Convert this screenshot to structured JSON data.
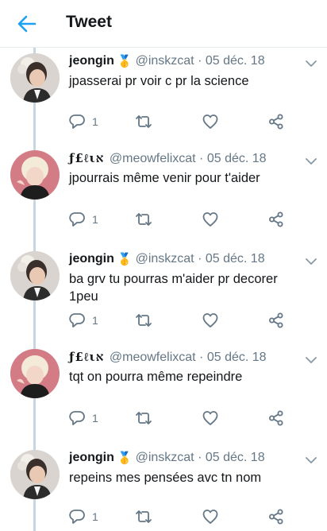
{
  "header": {
    "title": "Tweet",
    "accent": "#1da1f2"
  },
  "colors": {
    "text": "#14171a",
    "secondary": "#657786",
    "thread_line": "#c8d6e1",
    "icon": "#657786"
  },
  "icons": {
    "back": "back-arrow-icon",
    "more": "chevron-down-icon",
    "reply": "reply-icon",
    "retweet": "retweet-icon",
    "like": "heart-icon",
    "share": "share-icon",
    "medal": "medal-icon"
  },
  "tweets": [
    {
      "display_name": "jeongin",
      "medal": "🥇",
      "handle": "@inskzcat",
      "separator": "·",
      "date": "05 déc. 18",
      "text": "jpasserai pr voir c pr la science",
      "reply_count": "1"
    },
    {
      "display_name": "ƒ£ℓιא",
      "medal": "",
      "handle": "@meowfelixcat",
      "separator": "·",
      "date": "05 déc. 18",
      "text": "jpourrais même venir pour t'aider",
      "reply_count": "1"
    },
    {
      "display_name": "jeongin",
      "medal": "🥇",
      "handle": "@inskzcat",
      "separator": "·",
      "date": "05 déc. 18",
      "text": "ba grv tu pourras m'aider pr decorer 1peu",
      "reply_count": "1"
    },
    {
      "display_name": "ƒ£ℓιא",
      "medal": "",
      "handle": "@meowfelixcat",
      "separator": "·",
      "date": "05 déc. 18",
      "text": "tqt on pourra même repeindre",
      "reply_count": "1"
    },
    {
      "display_name": "jeongin",
      "medal": "🥇",
      "handle": "@inskzcat",
      "separator": "·",
      "date": "05 déc. 18",
      "text": "repeins mes pensées avc tn nom",
      "reply_count": "1"
    }
  ]
}
